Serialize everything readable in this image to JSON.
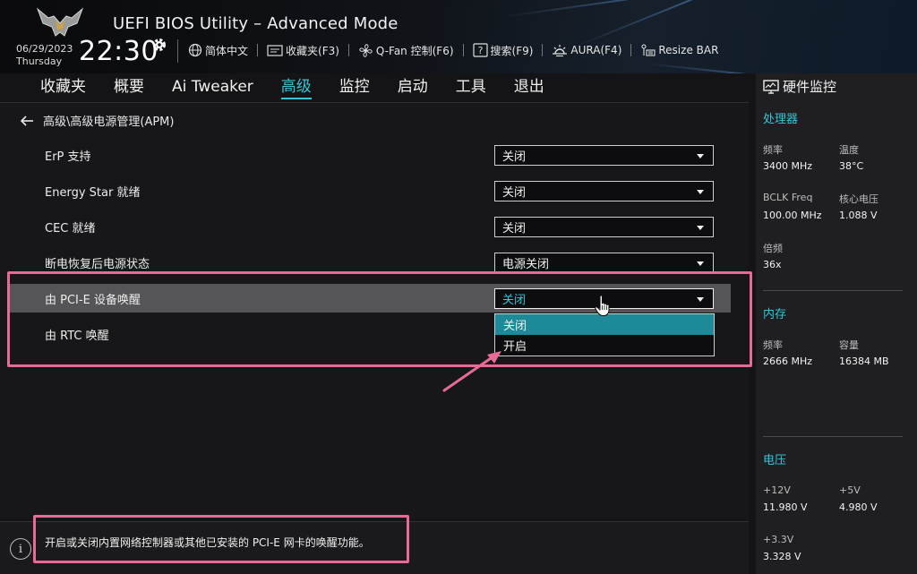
{
  "header": {
    "title": "UEFI BIOS Utility – Advanced Mode",
    "date": "06/29/2023",
    "day": "Thursday",
    "time": "22:30",
    "toolbar": [
      {
        "icon": "globe-icon",
        "label": "简体中文"
      },
      {
        "icon": "favorites-icon",
        "label": "收藏夹(F3)"
      },
      {
        "icon": "fan-icon",
        "label": "Q-Fan 控制(F6)"
      },
      {
        "icon": "help-search-icon",
        "label": "搜索(F9)"
      },
      {
        "icon": "aura-icon",
        "label": "AURA(F4)"
      },
      {
        "icon": "resize-bar-icon",
        "label": "Resize BAR"
      }
    ]
  },
  "nav": {
    "tabs": [
      {
        "label": "收藏夹",
        "active": false
      },
      {
        "label": "概要",
        "active": false
      },
      {
        "label": "Ai Tweaker",
        "active": false
      },
      {
        "label": "高级",
        "active": true
      },
      {
        "label": "监控",
        "active": false
      },
      {
        "label": "启动",
        "active": false
      },
      {
        "label": "工具",
        "active": false
      },
      {
        "label": "退出",
        "active": false
      }
    ]
  },
  "main": {
    "breadcrumb": "高级\\高级电源管理(APM)",
    "settings": [
      {
        "label": "ErP 支持",
        "value": "关闭"
      },
      {
        "label": "Energy Star 就绪",
        "value": "关闭"
      },
      {
        "label": "CEC 就绪",
        "value": "关闭"
      },
      {
        "label": "断电恢复后电源状态",
        "value": "电源关闭"
      },
      {
        "label": "由 PCI-E 设备唤醒",
        "value": "关闭"
      },
      {
        "label": "由 RTC 唤醒",
        "value": ""
      }
    ],
    "dropdown_options": [
      "关闭",
      "开启"
    ],
    "highlighted_option": "关闭"
  },
  "help": {
    "text": "开启或关闭内置网络控制器或其他已安装的 PCI-E 网卡的唤醒功能。"
  },
  "hw_monitor": {
    "title": "硬件监控",
    "cpu": {
      "heading": "处理器",
      "freq_label": "频率",
      "freq": "3400 MHz",
      "temp_label": "温度",
      "temp": "38°C",
      "bclk_label": "BCLK Freq",
      "bclk": "100.00 MHz",
      "vcore_label": "核心电压",
      "vcore": "1.088 V",
      "ratio_label": "倍频",
      "ratio": "36x"
    },
    "memory": {
      "heading": "内存",
      "freq_label": "频率",
      "freq": "2666 MHz",
      "cap_label": "容量",
      "cap": "16384 MB"
    },
    "voltage": {
      "heading": "电压",
      "v12_label": "+12V",
      "v12": "11.980 V",
      "v5_label": "+5V",
      "v5": "4.980 V",
      "v33_label": "+3.3V",
      "v33": "3.328 V"
    }
  },
  "colors": {
    "accent": "#33c6d8",
    "highlight": "#1c8a99",
    "annotation": "#e86a96"
  }
}
